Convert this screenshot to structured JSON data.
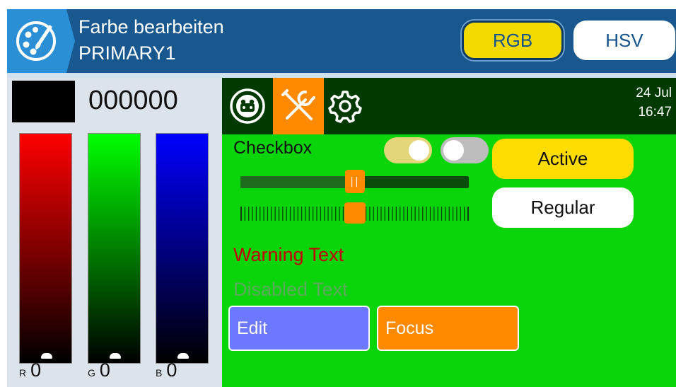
{
  "header": {
    "title": "Farbe bearbeiten",
    "subtitle": "PRIMARY1",
    "icon": "palette-icon",
    "mode_buttons": [
      {
        "label": "RGB",
        "selected": true
      },
      {
        "label": "HSV",
        "selected": false
      }
    ]
  },
  "color_editor": {
    "hex_value": "000000",
    "swatch_color": "#000000",
    "channels": [
      {
        "letter": "R",
        "value": "0",
        "level": 0,
        "color": "#ff0000"
      },
      {
        "letter": "G",
        "value": "0",
        "level": 0,
        "color": "#00ff00"
      },
      {
        "letter": "B",
        "value": "0",
        "level": 0,
        "color": "#0000ff"
      }
    ]
  },
  "preview": {
    "tabs": [
      {
        "icon": "radio-model-icon",
        "active": false
      },
      {
        "icon": "tools-icon",
        "active": true
      },
      {
        "icon": "gear-icon",
        "active": false
      }
    ],
    "date": "24 Jul",
    "time": "16:47",
    "checkbox_label": "Checkbox",
    "toggles": [
      {
        "state": "on"
      },
      {
        "state": "off"
      }
    ],
    "slider_level": 0.5,
    "tick_slider_level": 0.5,
    "buttons": {
      "active_label": "Active",
      "regular_label": "Regular"
    },
    "warning_text": "Warning Text",
    "disabled_text": "Disabled Text",
    "edit_label": "Edit",
    "focus_label": "Focus",
    "colors": {
      "background": "#0ad40a",
      "top_bar": "#003a00",
      "accent": "#ff8a00",
      "active": "#ffdc00",
      "edit": "#6b78ff",
      "warning": "#c40000"
    }
  }
}
